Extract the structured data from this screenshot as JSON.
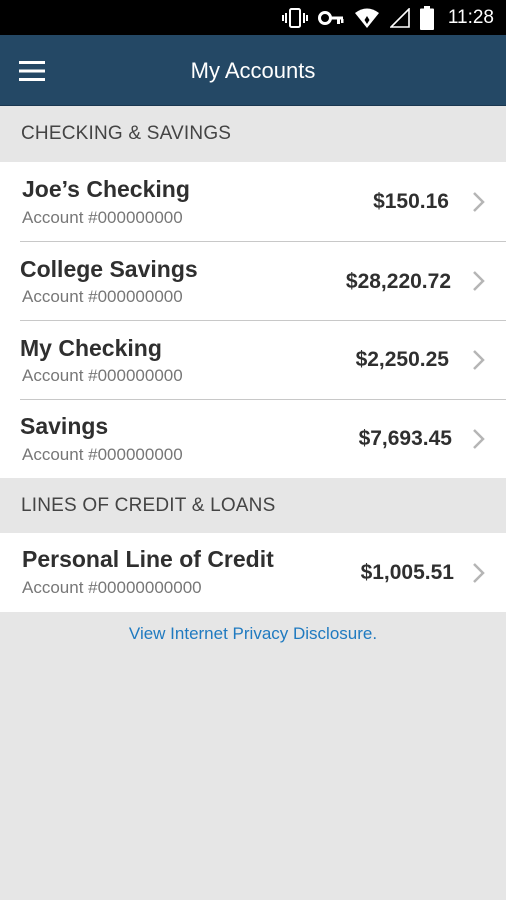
{
  "status_bar": {
    "time": "11:28",
    "icons": [
      "vibrate-icon",
      "key-icon",
      "wifi-icon",
      "signal-icon",
      "battery-icon"
    ]
  },
  "app_bar": {
    "title": "My Accounts",
    "menu_icon": "hamburger-menu-icon",
    "background": "#244865"
  },
  "sections": [
    {
      "header": "CHECKING & SAVINGS",
      "accounts": [
        {
          "name": "Joe’s Checking",
          "number": "Account #000000000",
          "balance": "$150.16"
        },
        {
          "name": "College Savings",
          "number": "Account #000000000",
          "balance": "$28,220.72"
        },
        {
          "name": "My Checking",
          "number": "Account #000000000",
          "balance": "$2,250.25"
        },
        {
          "name": "Savings",
          "number": "Account #000000000",
          "balance": "$7,693.45"
        }
      ]
    },
    {
      "header": "LINES OF CREDIT & LOANS",
      "accounts": [
        {
          "name": "Personal Line of Credit",
          "number": "Account #00000000000",
          "balance": "$1,005.51"
        }
      ]
    }
  ],
  "footer": {
    "privacy_link": "View Internet Privacy Disclosure.",
    "link_color": "#1f7ac0"
  }
}
